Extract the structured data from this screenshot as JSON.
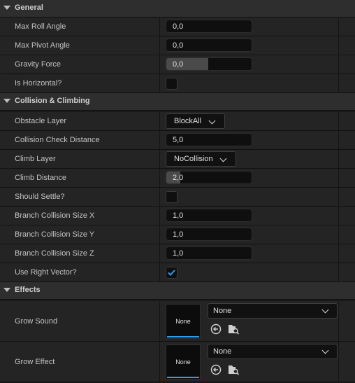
{
  "sections": {
    "general": "General",
    "collision": "Collision & Climbing",
    "effects": "Effects"
  },
  "general": {
    "max_roll_label": "Max Roll Angle",
    "max_roll_value": "0,0",
    "max_pivot_label": "Max Pivot Angle",
    "max_pivot_value": "0,0",
    "gravity_label": "Gravity Force",
    "gravity_value": "0,0",
    "horizontal_label": "Is Horizontal?",
    "horizontal_checked": false
  },
  "collision": {
    "obstacle_label": "Obstacle Layer",
    "obstacle_value": "BlockAll",
    "check_distance_label": "Collision Check Distance",
    "check_distance_value": "5,0",
    "climb_layer_label": "Climb Layer",
    "climb_layer_value": "NoCollision",
    "climb_distance_label": "Climb Distance",
    "climb_distance_value": "2,0",
    "settle_label": "Should Settle?",
    "settle_checked": false,
    "size_x_label": "Branch Collision Size X",
    "size_x_value": "1,0",
    "size_y_label": "Branch Collision Size Y",
    "size_y_value": "1,0",
    "size_z_label": "Branch Collision Size Z",
    "size_z_value": "1,0",
    "right_vector_label": "Use Right Vector?",
    "right_vector_checked": true
  },
  "effects": {
    "grow_sound_label": "Grow Sound",
    "grow_sound_thumb": "None",
    "grow_sound_value": "None",
    "grow_effect_label": "Grow Effect",
    "grow_effect_thumb": "None",
    "grow_effect_value": "None"
  },
  "colors": {
    "accent": "#2c9df0",
    "check": "#2c9df0"
  },
  "icons": [
    "chevron-down-icon",
    "use-selected-icon",
    "browse-asset-icon",
    "checkmark-icon"
  ]
}
